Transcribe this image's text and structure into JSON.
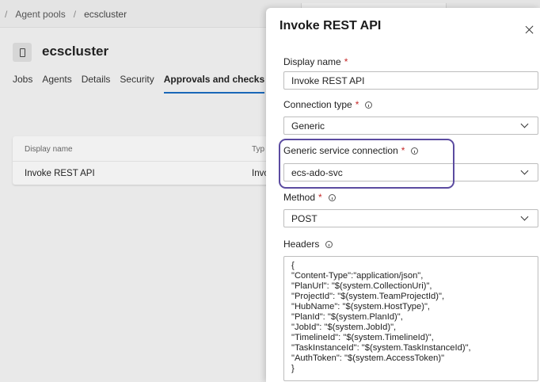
{
  "breadcrumb": {
    "items": [
      "Agent pools",
      "ecscluster"
    ]
  },
  "pool": {
    "title": "ecscluster"
  },
  "tabs": [
    {
      "label": "Jobs"
    },
    {
      "label": "Agents"
    },
    {
      "label": "Details"
    },
    {
      "label": "Security"
    },
    {
      "label": "Approvals and checks",
      "active": true
    }
  ],
  "checks_table": {
    "columns": [
      "Display name",
      "Typ"
    ],
    "rows": [
      {
        "name": "Invoke REST API",
        "type": "Invo"
      }
    ]
  },
  "panel": {
    "title": "Invoke REST API",
    "display_name": {
      "label": "Display name",
      "value": "Invoke REST API"
    },
    "connection_type": {
      "label": "Connection type",
      "value": "Generic"
    },
    "service_connection": {
      "label": "Generic service connection",
      "value": "ecs-ado-svc"
    },
    "method": {
      "label": "Method",
      "value": "POST"
    },
    "headers": {
      "label": "Headers",
      "lines": [
        "{",
        "\"Content-Type\":\"application/json\",",
        "\"PlanUrl\": \"$(system.CollectionUri)\",",
        "\"ProjectId\": \"$(system.TeamProjectId)\",",
        "\"HubName\": \"$(system.HostType)\",",
        "\"PlanId\": \"$(system.PlanId)\",",
        "\"JobId\": \"$(system.JobId)\",",
        "\"TimelineId\": \"$(system.TimelineId)\",",
        "\"TaskInstanceId\": \"$(system.TaskInstanceId)\",",
        "\"AuthToken\": \"$(system.AccessToken)\"",
        "}"
      ]
    },
    "required_marker": "*"
  },
  "colors": {
    "highlight": "#5b4ba0",
    "required": "#c62828",
    "active_tab": "#1a67b8"
  }
}
